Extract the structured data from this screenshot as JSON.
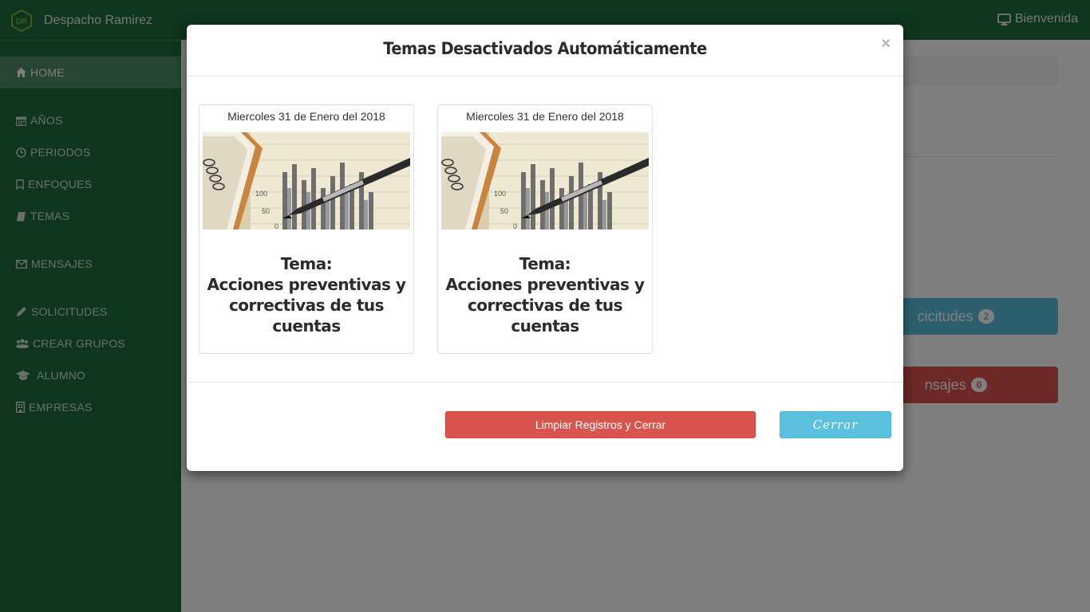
{
  "navbar": {
    "brand_initials": "DR",
    "brand_name": "Despacho Ramirez",
    "user_greeting": "Bienvenida",
    "color": "#1e6a3c"
  },
  "sidebar": {
    "items": [
      {
        "label": "HOME",
        "icon": "home-icon",
        "active": true
      },
      {
        "label": "AÑOS",
        "icon": "calendar-icon"
      },
      {
        "label": "PERIODOS",
        "icon": "clock-icon"
      },
      {
        "label": "ENFOQUES",
        "icon": "bookmark-icon"
      },
      {
        "label": "TEMAS",
        "icon": "book-icon"
      },
      {
        "label": "MENSAJES",
        "icon": "envelope-icon"
      },
      {
        "label": "SOLICITUDES",
        "icon": "pencil-icon"
      },
      {
        "label": "CREAR GRUPOS",
        "icon": "users-icon"
      },
      {
        "label": "ALUMNO",
        "icon": "graduation-cap-icon"
      },
      {
        "label": "EMPRESAS",
        "icon": "building-icon"
      }
    ]
  },
  "background": {
    "solicitudes_label": "cicitudes",
    "solicitudes_count": "2",
    "mensajes_label": "nsajes",
    "mensajes_count": "0"
  },
  "modal": {
    "title": "Temas Desactivados Automáticamente",
    "close_symbol": "×",
    "cards": [
      {
        "date": "Miercoles 31 de Enero del 2018",
        "title_prefix": "Tema:",
        "title_lines": [
          "Acciones preventivas y",
          "correctivas de tus",
          "cuentas"
        ]
      },
      {
        "date": "Miercoles 31 de Enero del 2018",
        "title_prefix": "Tema:",
        "title_lines": [
          "Acciones preventivas y",
          "correctivas de tus",
          "cuentas"
        ]
      }
    ],
    "clear_button": "Limpiar Registros y Cerrar",
    "close_button": "Cerrar"
  },
  "colors": {
    "danger": "#d9534f",
    "info": "#5bc0de"
  }
}
